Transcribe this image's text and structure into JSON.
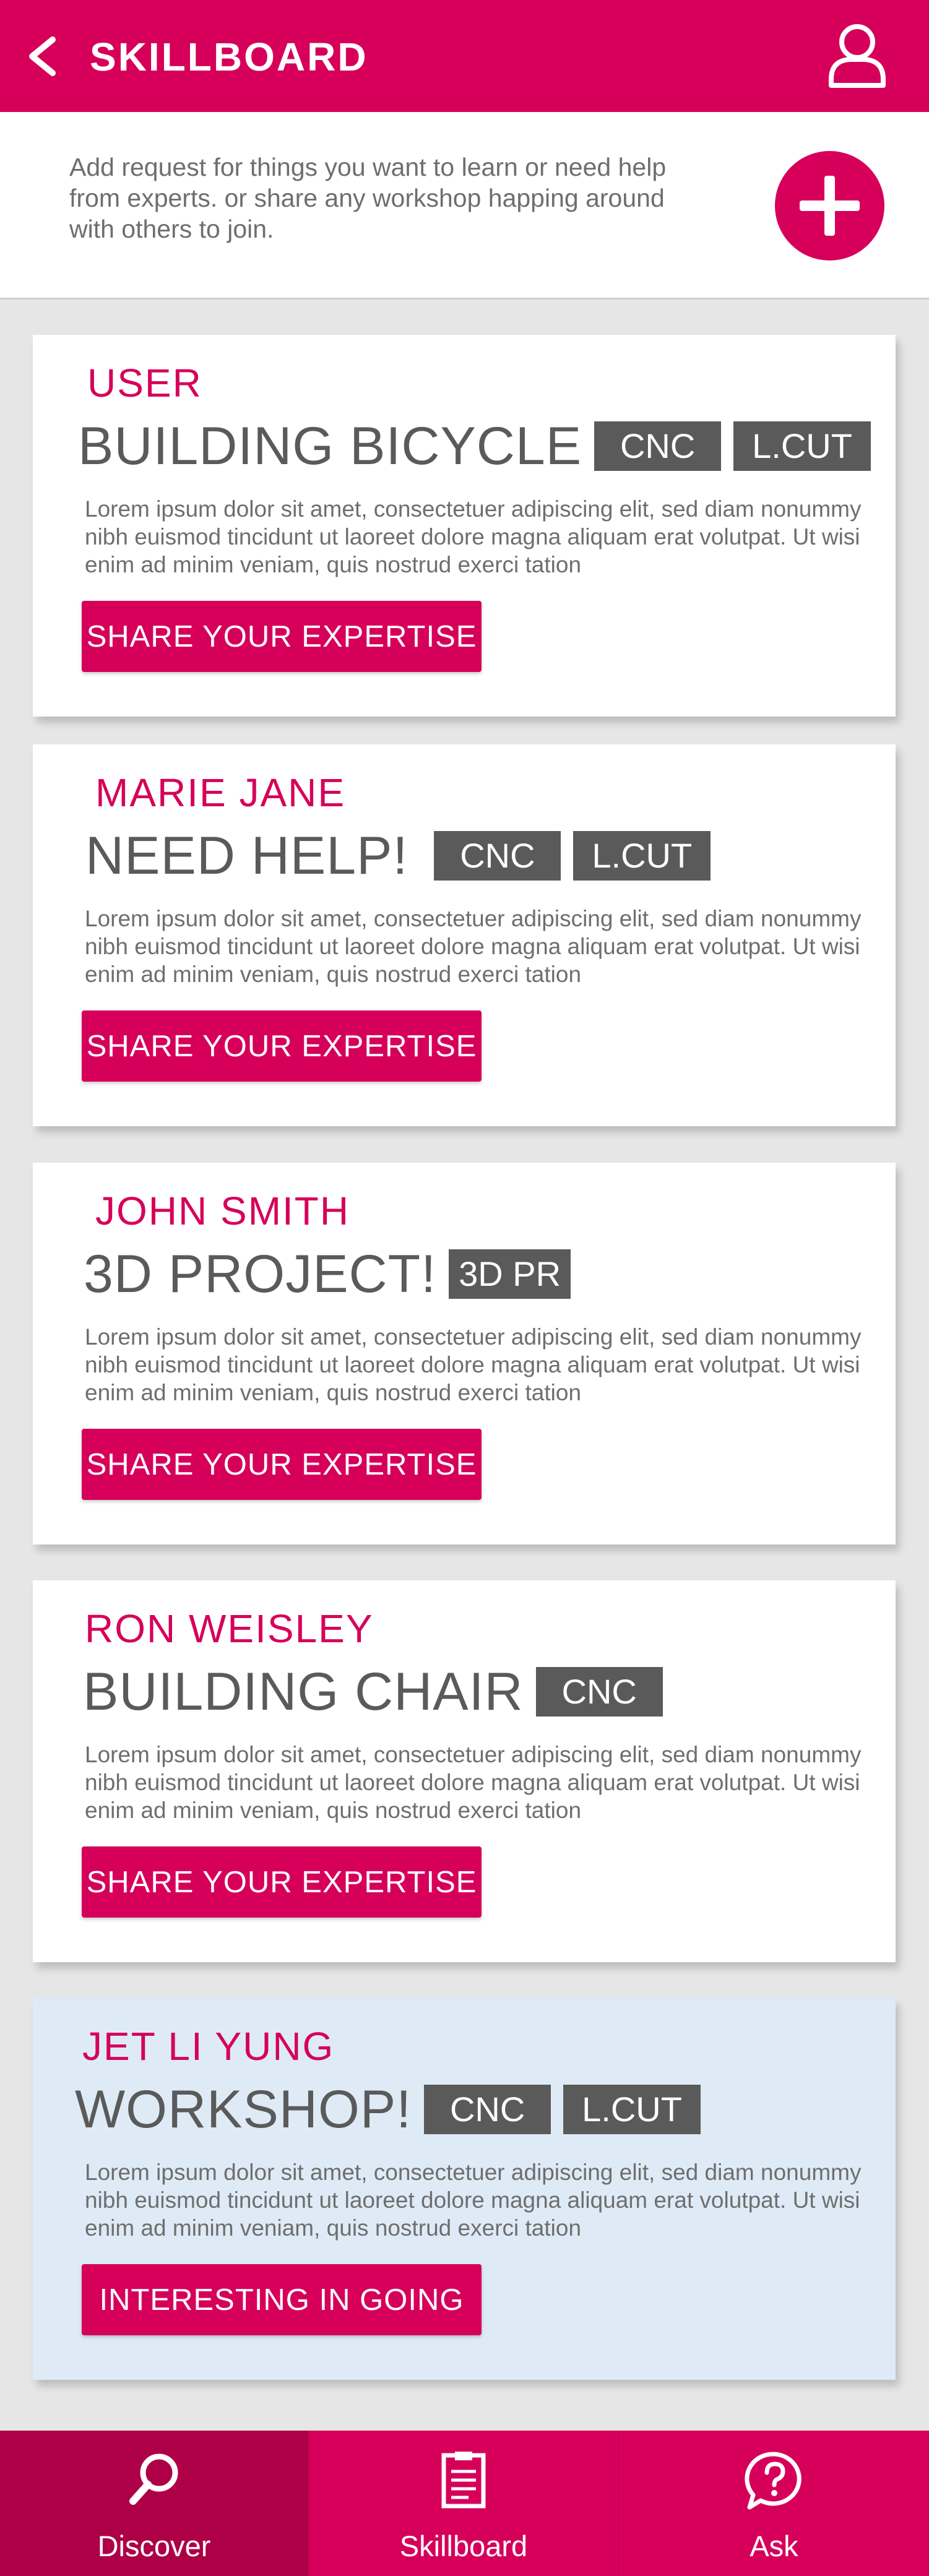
{
  "header": {
    "title": "SKILLBOARD",
    "back_icon": "chevron-left-icon",
    "profile_icon": "user-icon"
  },
  "intro": {
    "text": "Add request for things you want to learn  or need help from experts. or share any workshop happing around with others to join.",
    "add_icon": "plus-icon"
  },
  "cards": [
    {
      "user": "USER",
      "title": "BUILDING BICYCLE",
      "tags": [
        "CNC",
        "L.CUT"
      ],
      "description": "Lorem ipsum dolor sit amet, consectetuer adipiscing elit, sed diam nonummy nibh euismod tincidunt ut laoreet dolore magna aliquam erat volutpat. Ut wisi enim ad minim veniam, quis nostrud exerci tation",
      "button_label": "SHARE YOUR EXPERTISE"
    },
    {
      "user": "MARIE JANE",
      "title": "NEED HELP!",
      "tags": [
        "CNC",
        "L.CUT"
      ],
      "description": "Lorem ipsum dolor sit amet, consectetuer adipiscing elit, sed diam nonummy nibh euismod tincidunt ut laoreet dolore magna aliquam erat volutpat. Ut wisi enim ad minim veniam, quis nostrud exerci tation",
      "button_label": "SHARE YOUR EXPERTISE"
    },
    {
      "user": "JOHN SMITH",
      "title": "3D PROJECT!",
      "tags": [
        "3D PR"
      ],
      "description": "Lorem ipsum dolor sit amet, consectetuer adipiscing elit, sed diam nonummy nibh euismod tincidunt ut laoreet dolore magna aliquam erat volutpat. Ut wisi enim ad minim veniam, quis nostrud exerci tation",
      "button_label": "SHARE YOUR EXPERTISE"
    },
    {
      "user": "RON WEISLEY",
      "title": "BUILDING CHAIR",
      "tags": [
        "CNC"
      ],
      "description": "Lorem ipsum dolor sit amet, consectetuer adipiscing elit, sed diam nonummy nibh euismod tincidunt ut laoreet dolore magna aliquam erat volutpat. Ut wisi enim ad minim veniam, quis nostrud exerci tation",
      "button_label": "SHARE YOUR EXPERTISE"
    },
    {
      "user": "JET LI YUNG",
      "title": "WORKSHOP!",
      "tags": [
        "CNC",
        "L.CUT"
      ],
      "description": "Lorem ipsum dolor sit amet, consectetuer adipiscing elit, sed diam nonummy nibh euismod tincidunt ut laoreet dolore magna aliquam erat volutpat. Ut wisi enim ad minim veniam, quis nostrud exerci tation",
      "button_label": "INTERESTING IN GOING"
    }
  ],
  "bottom_nav": [
    {
      "label": "Discover",
      "icon": "search-icon",
      "active": true
    },
    {
      "label": "Skillboard",
      "icon": "clipboard-icon",
      "active": false
    },
    {
      "label": "Ask",
      "icon": "question-bubble-icon",
      "active": false
    }
  ],
  "colors": {
    "accent": "#d6005a",
    "nav_active": "#ad0047",
    "tag": "#5a5a5a",
    "workshop_card": "#deebf7",
    "background": "#e6e6e6"
  }
}
